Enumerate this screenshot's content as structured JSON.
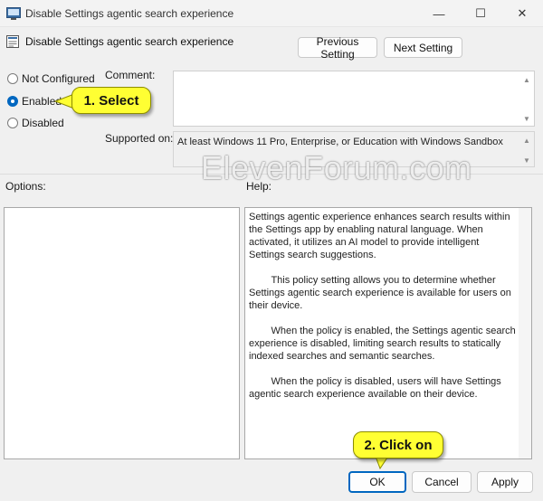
{
  "window": {
    "title": "Disable Settings agentic search experience",
    "minimize_glyph": "—",
    "maximize_glyph": "☐",
    "close_glyph": "✕"
  },
  "header": {
    "title": "Disable Settings agentic search experience",
    "prev_button": "Previous Setting",
    "next_button": "Next Setting"
  },
  "state": {
    "options": [
      {
        "label": "Not Configured",
        "checked": false
      },
      {
        "label": "Enabled",
        "checked": true
      },
      {
        "label": "Disabled",
        "checked": false
      }
    ]
  },
  "comment": {
    "label": "Comment:",
    "value": ""
  },
  "supported": {
    "label": "Supported on:",
    "value": "At least Windows 11 Pro, Enterprise, or Education with Windows Sandbox"
  },
  "options_label": "Options:",
  "help_label": "Help:",
  "help_paragraphs": [
    "Settings agentic experience enhances search results within the Settings app by enabling natural language. When activated, it utilizes an AI model to provide intelligent Settings search suggestions.",
    "        This policy setting allows you to determine whether Settings agentic search experience is available for users on their device.",
    "        When the policy is enabled, the Settings agentic search experience is disabled, limiting search results to statically indexed searches and semantic searches.",
    "        When the policy is disabled, users will have Settings agentic search experience available on their device."
  ],
  "footer": {
    "ok": "OK",
    "cancel": "Cancel",
    "apply": "Apply"
  },
  "watermark": "ElevenForum.com",
  "annotations": {
    "step1": "1. Select",
    "step2": "2. Click on"
  },
  "colors": {
    "accent": "#0067c0",
    "callout": "#ffff33"
  }
}
